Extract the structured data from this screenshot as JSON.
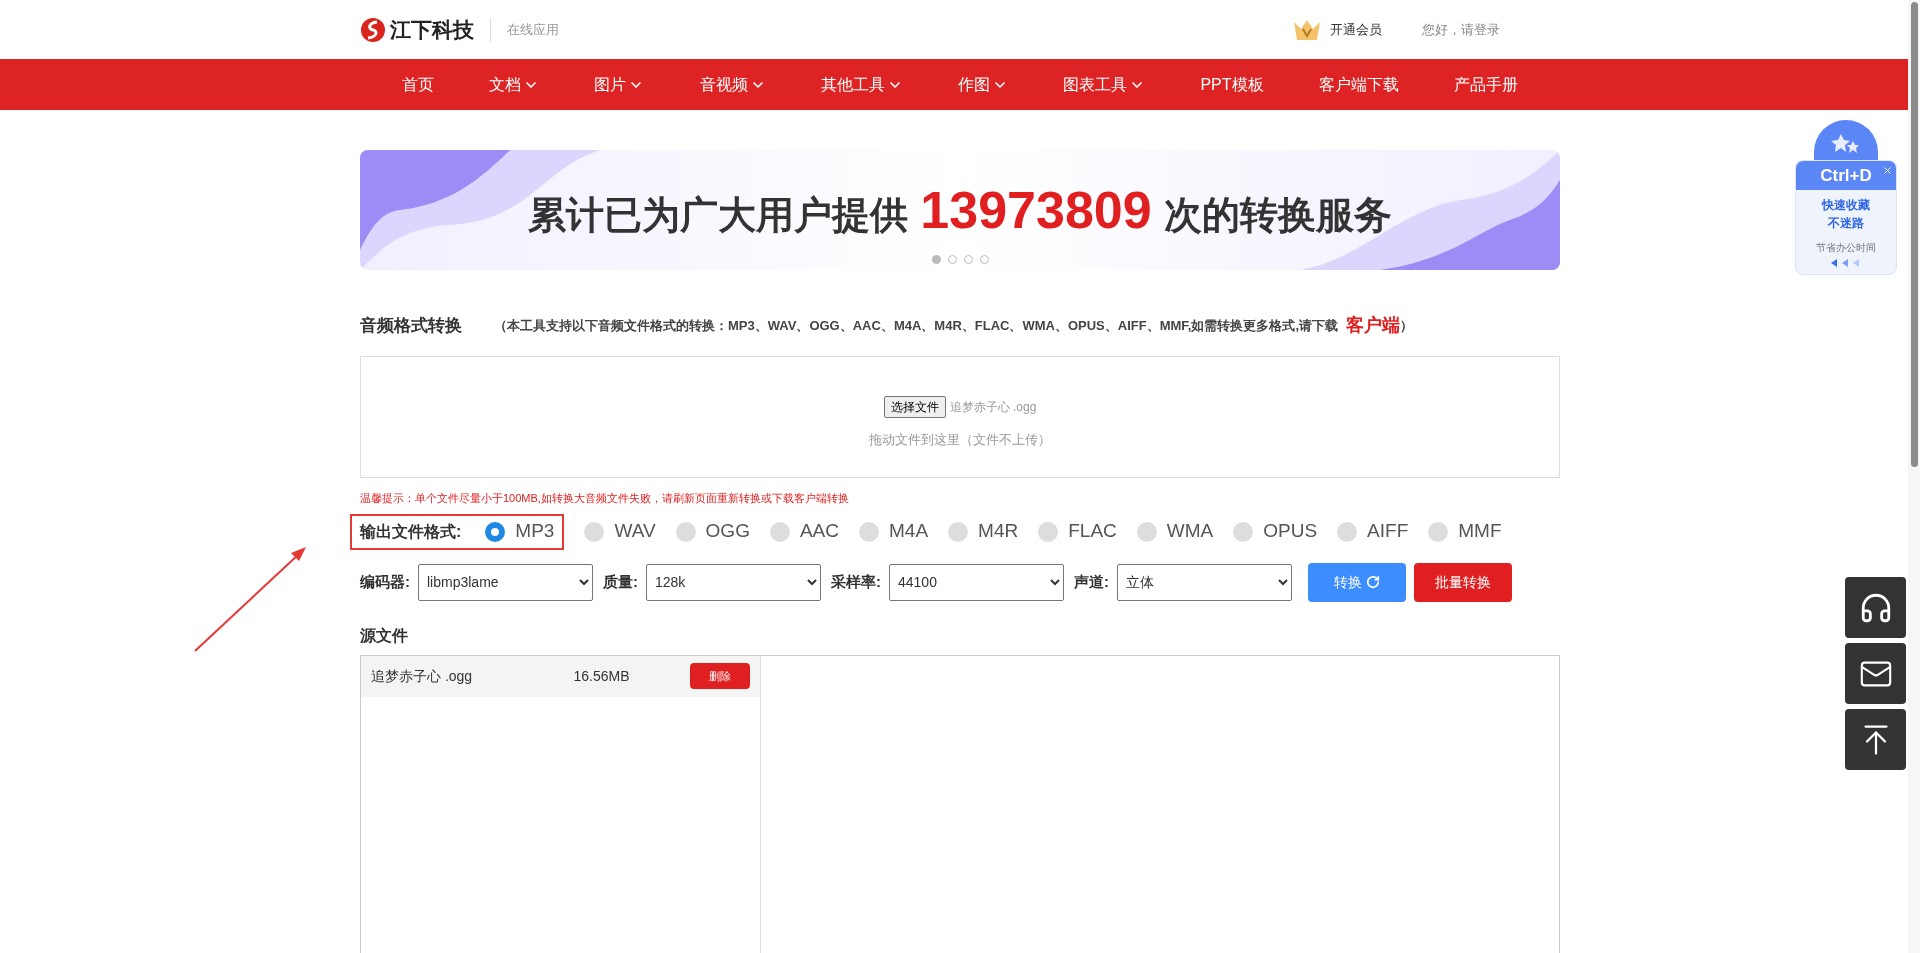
{
  "header": {
    "brand": "江下科技",
    "subtitle": "在线应用",
    "vip": "开通会员",
    "login": "您好，请登录"
  },
  "nav": [
    {
      "label": "首页",
      "dropdown": false
    },
    {
      "label": "文档",
      "dropdown": true
    },
    {
      "label": "图片",
      "dropdown": true
    },
    {
      "label": "音视频",
      "dropdown": true
    },
    {
      "label": "其他工具",
      "dropdown": true
    },
    {
      "label": "作图",
      "dropdown": true
    },
    {
      "label": "图表工具",
      "dropdown": true
    },
    {
      "label": "PPT模板",
      "dropdown": false
    },
    {
      "label": "客户端下载",
      "dropdown": false
    },
    {
      "label": "产品手册",
      "dropdown": false
    }
  ],
  "banner": {
    "prefix": "累计已为广大用户提供",
    "count": "13973809",
    "suffix": "次的转换服务",
    "dots": [
      {
        "selected": true
      },
      {
        "selected": false
      },
      {
        "selected": false
      },
      {
        "selected": false
      }
    ]
  },
  "tool": {
    "title": "音频格式转换",
    "note": "（本工具支持以下音频文件格式的转换：MP3、WAV、OGG、AAC、M4A、M4R、FLAC、WMA、OPUS、AIFF、MMF,如需转换更多格式,请下载",
    "note_link": "客户端",
    "note_end": "）"
  },
  "upload": {
    "button": "选择文件",
    "file_name": "追梦赤子心 .ogg",
    "hint": "拖动文件到这里（文件不上传）"
  },
  "warning": "温馨提示：单个文件尽量小于100MB,如转换大音频文件失败，请刷新页面重新转换或下载客户端转换",
  "format": {
    "label": "输出文件格式:",
    "options": [
      {
        "label": "MP3",
        "selected": true
      },
      {
        "label": "WAV",
        "selected": false
      },
      {
        "label": "OGG",
        "selected": false
      },
      {
        "label": "AAC",
        "selected": false
      },
      {
        "label": "M4A",
        "selected": false
      },
      {
        "label": "M4R",
        "selected": false
      },
      {
        "label": "FLAC",
        "selected": false
      },
      {
        "label": "WMA",
        "selected": false
      },
      {
        "label": "OPUS",
        "selected": false
      },
      {
        "label": "AIFF",
        "selected": false
      },
      {
        "label": "MMF",
        "selected": false
      }
    ]
  },
  "settings": [
    {
      "label": "编码器:",
      "value": "libmp3lame"
    },
    {
      "label": "质量:",
      "value": "128k"
    },
    {
      "label": "采样率:",
      "value": "44100"
    },
    {
      "label": "声道:",
      "value": "立体"
    }
  ],
  "buttons": [
    {
      "label": "转换",
      "kind": "primary"
    },
    {
      "label": "批量转换",
      "kind": "danger"
    }
  ],
  "source": {
    "title": "源文件",
    "files": [
      {
        "name": "追梦赤子心 .ogg",
        "size": "16.56MB",
        "action": "删除"
      }
    ]
  },
  "side_card": {
    "shortcut": "Ctrl+D",
    "line1": "快速收藏",
    "line2": "不迷路",
    "tagline": "节省办公时间"
  }
}
